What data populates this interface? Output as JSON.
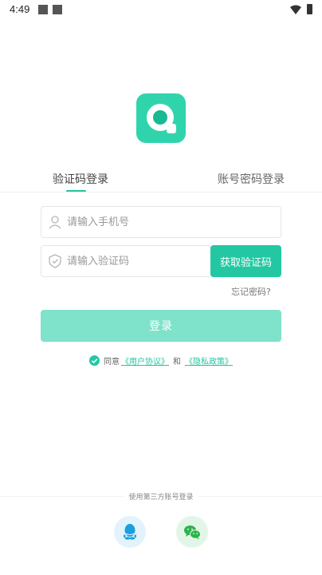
{
  "status_bar": {
    "time": "4:49"
  },
  "tabs": [
    {
      "label": "验证码登录",
      "active": true
    },
    {
      "label": "账号密码登录",
      "active": false
    }
  ],
  "phone_field": {
    "placeholder": "请输入手机号",
    "value": ""
  },
  "code_field": {
    "placeholder": "请输入验证码",
    "value": ""
  },
  "get_code_button": {
    "label": "获取验证码"
  },
  "forgot_password": {
    "label": "忘记密码?"
  },
  "login_button": {
    "label": "登录"
  },
  "agreement": {
    "checked": true,
    "prefix": "同意",
    "user_agreement": "《用户协议》",
    "conjunction": "和",
    "privacy_policy": "《隐私政策》"
  },
  "third_party": {
    "label": "使用第三方账号登录",
    "providers": [
      {
        "icon": "qq-icon",
        "color": "#1a9fe0"
      },
      {
        "icon": "wechat-icon",
        "color": "#2bb34a"
      }
    ]
  },
  "colors": {
    "accent": "#23c8a3",
    "accent_light": "#7fe2ca"
  }
}
